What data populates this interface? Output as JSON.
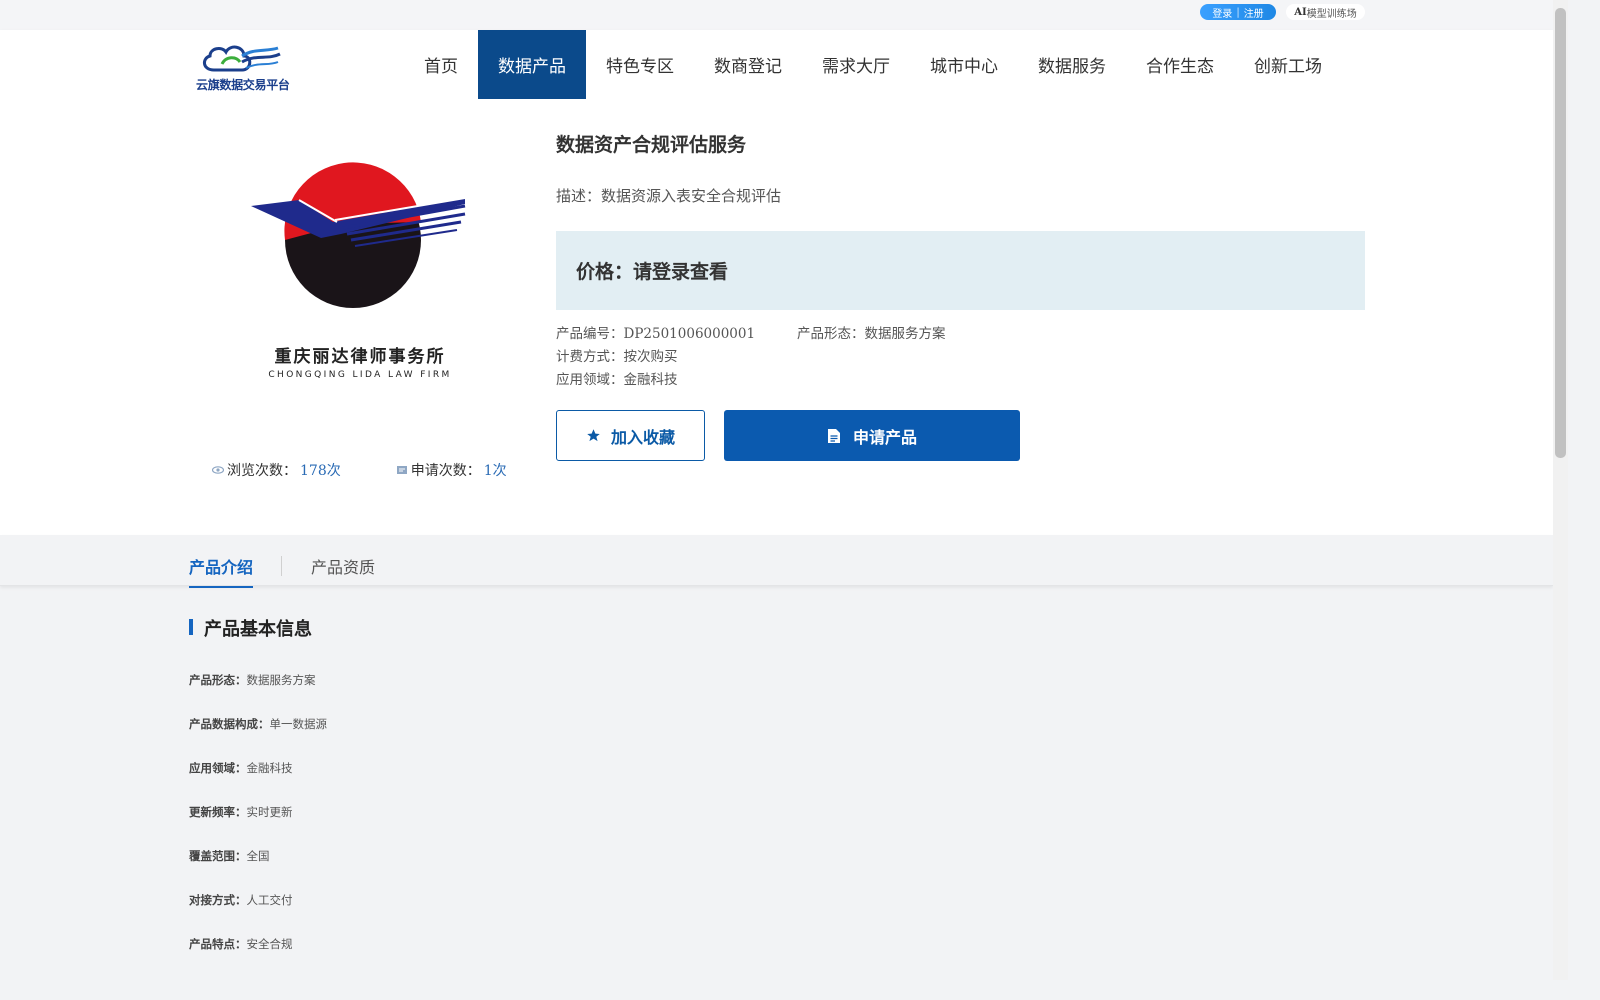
{
  "topbar": {
    "login": "登录",
    "separator": "|",
    "register": "注册",
    "ai_label_bold": "AI",
    "ai_label_rest": "模型训练场"
  },
  "brand": {
    "name": "云旗数据交易平台",
    "colors": {
      "primary": "#0b4a8b",
      "accent": "#1565c0"
    }
  },
  "nav": {
    "items": [
      {
        "label": "首页",
        "active": false
      },
      {
        "label": "数据产品",
        "active": true
      },
      {
        "label": "特色专区",
        "active": false
      },
      {
        "label": "数商登记",
        "active": false
      },
      {
        "label": "需求大厅",
        "active": false
      },
      {
        "label": "城市中心",
        "active": false
      },
      {
        "label": "数据服务",
        "active": false
      },
      {
        "label": "合作生态",
        "active": false
      },
      {
        "label": "创新工场",
        "active": false
      }
    ]
  },
  "product": {
    "firm_name_cn": "重庆丽达律师事务所",
    "firm_name_en": "CHONGQING LIDA LAW FIRM",
    "title": "数据资产合规评估服务",
    "description": "描述：数据资源入表安全合规评估",
    "price": "价格：请登录查看",
    "meta": {
      "code_label": "产品编号：",
      "code_value": "DP2501006000001",
      "form_label": "产品形态：",
      "form_value": "数据服务方案",
      "billing_label": "计费方式：",
      "billing_value": "按次购买",
      "domain_label": "应用领域：",
      "domain_value": "金融科技"
    },
    "stats": {
      "views_label": "浏览次数：",
      "views_value": "178次",
      "applies_label": "申请次数：",
      "applies_value": "1次"
    },
    "buttons": {
      "favorite": "加入收藏",
      "apply": "申请产品"
    }
  },
  "tabs": [
    {
      "label": "产品介绍",
      "active": true
    },
    {
      "label": "产品资质",
      "active": false
    }
  ],
  "basic_info": {
    "title": "产品基本信息",
    "rows": [
      {
        "label": "产品形态：",
        "value": "数据服务方案"
      },
      {
        "label": "产品数据构成：",
        "value": "单一数据源"
      },
      {
        "label": "应用领域：",
        "value": "金融科技"
      },
      {
        "label": "更新频率：",
        "value": "实时更新"
      },
      {
        "label": "覆盖范围：",
        "value": "全国"
      },
      {
        "label": "对接方式：",
        "value": "人工交付"
      },
      {
        "label": "产品特点：",
        "value": "安全合规"
      }
    ]
  }
}
